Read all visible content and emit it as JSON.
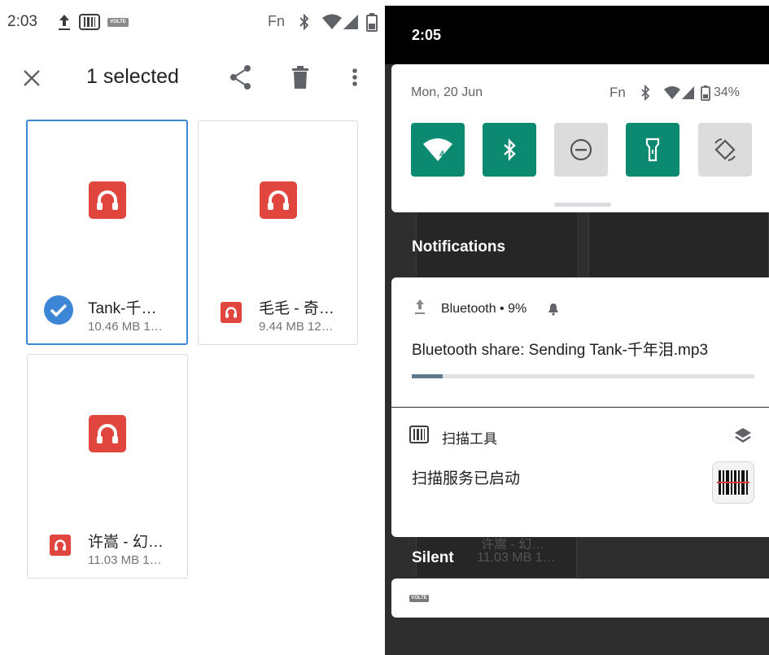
{
  "left": {
    "status": {
      "time": "2:03",
      "volte": "VOLTE",
      "fn": "Fn"
    },
    "toolbar": {
      "title": "1 selected"
    },
    "files": [
      {
        "name": "Tank-千…",
        "meta": "10.46 MB 1…",
        "selected": true
      },
      {
        "name": "毛毛 - 奇…",
        "meta": "9.44 MB 12…",
        "selected": false
      },
      {
        "name": "许嵩 - 幻…",
        "meta": "11.03 MB 1…",
        "selected": false
      }
    ]
  },
  "right": {
    "status": {
      "time": "2:05"
    },
    "quick_settings": {
      "date": "Mon, 20 Jun",
      "fn": "Fn",
      "battery": "34%",
      "wifi_badge": "4",
      "tiles": [
        "wifi-icon",
        "bluetooth-icon",
        "do-not-disturb-icon",
        "flashlight-icon",
        "auto-rotate-icon"
      ]
    },
    "notifications_header": "Notifications",
    "bluetooth_notification": {
      "app": "Bluetooth • 9%",
      "text": "Bluetooth share: Sending Tank-千年泪.mp3",
      "progress": 0.09
    },
    "scanner_notification": {
      "app": "扫描工具",
      "text": "扫描服务已启动"
    },
    "silent_header": "Silent",
    "ghost": {
      "name": "许嵩 - 幻…",
      "meta": "11.03 MB 1…"
    },
    "volte": "VOLTE"
  },
  "colors": {
    "accent_green": "#0c8a71",
    "selected_blue": "#3d86d6",
    "music_red": "#e0463e"
  }
}
